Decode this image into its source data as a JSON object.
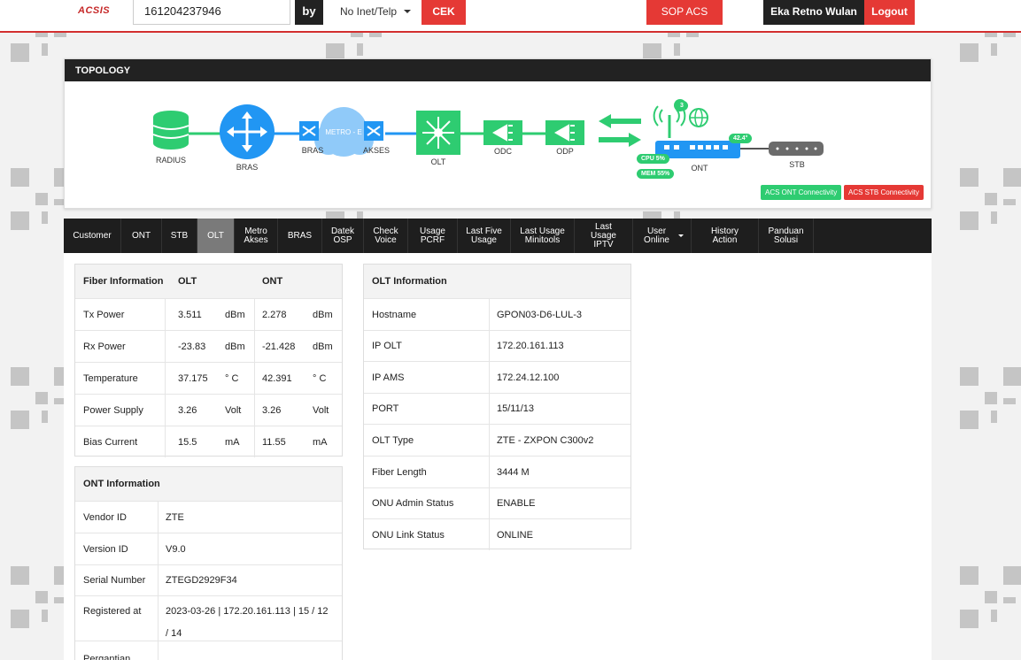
{
  "header": {
    "logo": "ACSIS",
    "search_value": "161204237946",
    "by_label": "by",
    "select_value": "No Inet/Telp",
    "cek_label": "CEK",
    "sop_label": "SOP ACS",
    "user_name": "Eka Retno Wulan",
    "logout_label": "Logout"
  },
  "topology": {
    "title": "TOPOLOGY",
    "nodes": {
      "radius": "RADIUS",
      "bras": "BRAS",
      "bras2": "BRAS",
      "metro": "METRO - E",
      "akses": "AKSES",
      "olt": "OLT",
      "odc": "ODC",
      "odp": "ODP",
      "ont": "ONT",
      "stb": "STB"
    },
    "wifi_count": "3",
    "temp": "42.4°",
    "cpu": "CPU 5%",
    "mem": "MEM 55%",
    "acs_ont": "ACS ONT Connectivity",
    "acs_stb": "ACS STB Connectivity",
    "colors": {
      "blue": "#2196f3",
      "green": "#2ecc71",
      "red": "#e53935"
    }
  },
  "tabs": [
    {
      "l1": "Customer",
      "l2": ""
    },
    {
      "l1": "ONT",
      "l2": ""
    },
    {
      "l1": "STB",
      "l2": ""
    },
    {
      "l1": "OLT",
      "l2": ""
    },
    {
      "l1": "Metro",
      "l2": "Akses"
    },
    {
      "l1": "BRAS",
      "l2": ""
    },
    {
      "l1": "Datek",
      "l2": "OSP"
    },
    {
      "l1": "Check",
      "l2": "Voice"
    },
    {
      "l1": "Usage",
      "l2": "PCRF"
    },
    {
      "l1": "Last Five",
      "l2": "Usage"
    },
    {
      "l1": "Last Usage",
      "l2": "Minitools"
    },
    {
      "l1": "Last Usage",
      "l2": "IPTV"
    },
    {
      "l1": "User Online",
      "l2": ""
    },
    {
      "l1": "History Action",
      "l2": ""
    },
    {
      "l1": "Panduan",
      "l2": "Solusi"
    }
  ],
  "fiber": {
    "headers": [
      "Fiber Information",
      "OLT",
      "ONT"
    ],
    "rows": [
      [
        "Tx Power",
        "3.511",
        "dBm",
        "2.278",
        "dBm"
      ],
      [
        "Rx Power",
        "-23.83",
        "dBm",
        "-21.428",
        "dBm"
      ],
      [
        "Temperature",
        "37.175",
        "° C",
        "42.391",
        "° C"
      ],
      [
        "Power Supply",
        "3.26",
        "Volt",
        "3.26",
        "Volt"
      ],
      [
        "Bias Current",
        "15.5",
        "mA",
        "11.55",
        "mA"
      ]
    ]
  },
  "olt_info": {
    "title": "OLT Information",
    "rows": [
      [
        "Hostname",
        "GPON03-D6-LUL-3"
      ],
      [
        "IP OLT",
        "172.20.161.113"
      ],
      [
        "IP AMS",
        "172.24.12.100"
      ],
      [
        "PORT",
        "15/11/13"
      ],
      [
        "OLT Type",
        "ZTE - ZXPON C300v2"
      ],
      [
        "Fiber Length",
        "3444 M"
      ],
      [
        "ONU Admin Status",
        "ENABLE"
      ],
      [
        "ONU Link Status",
        "ONLINE"
      ]
    ]
  },
  "ont_info": {
    "title": "ONT Information",
    "rows": [
      [
        "Vendor ID",
        "ZTE"
      ],
      [
        "Version ID",
        "V9.0"
      ],
      [
        "Serial Number",
        "ZTEGD2929F34"
      ],
      [
        "Registered at",
        "2023-03-26 | 172.20.161.113 | 15 / 12"
      ],
      [
        "",
        "/ 14"
      ],
      [
        "Pergantian",
        ""
      ]
    ]
  }
}
